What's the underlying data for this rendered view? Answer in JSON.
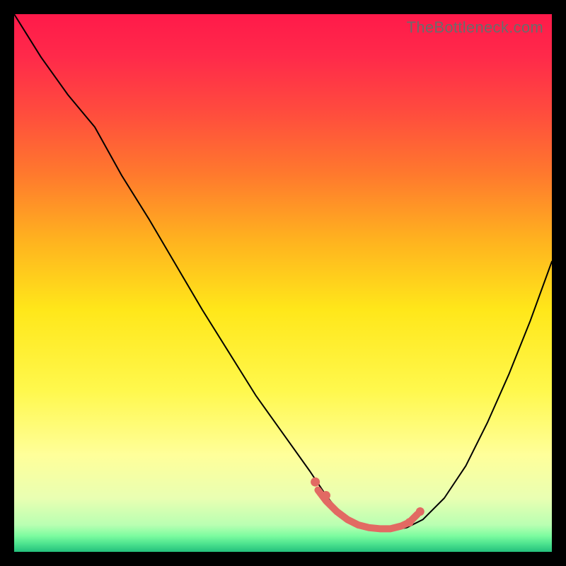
{
  "chart_data": {
    "type": "line",
    "title": "",
    "xlabel": "",
    "ylabel": "",
    "xlim": [
      0,
      100
    ],
    "ylim": [
      0,
      100
    ],
    "watermark": "TheBottleneck.com",
    "background_gradient": {
      "stops": [
        {
          "offset": 0.0,
          "color": "#ff1a4a"
        },
        {
          "offset": 0.08,
          "color": "#ff2a4a"
        },
        {
          "offset": 0.18,
          "color": "#ff4b3e"
        },
        {
          "offset": 0.3,
          "color": "#ff7a2d"
        },
        {
          "offset": 0.42,
          "color": "#ffb21f"
        },
        {
          "offset": 0.55,
          "color": "#ffe71a"
        },
        {
          "offset": 0.7,
          "color": "#fff84d"
        },
        {
          "offset": 0.82,
          "color": "#ffff9a"
        },
        {
          "offset": 0.9,
          "color": "#e9ffb2"
        },
        {
          "offset": 0.95,
          "color": "#b9ffb2"
        },
        {
          "offset": 0.97,
          "color": "#7dfca0"
        },
        {
          "offset": 0.985,
          "color": "#4de38f"
        },
        {
          "offset": 1.0,
          "color": "#24c07c"
        }
      ]
    },
    "series": [
      {
        "name": "bottleneck-curve",
        "color": "#000000",
        "width": 2,
        "x": [
          0,
          5,
          10,
          15,
          20,
          25,
          30,
          35,
          40,
          45,
          50,
          55,
          58,
          60,
          62,
          65,
          68,
          70,
          73,
          76,
          80,
          84,
          88,
          92,
          96,
          100
        ],
        "y": [
          100,
          92,
          85,
          79,
          70,
          62,
          53.5,
          45,
          37,
          29,
          22,
          15,
          10.5,
          8,
          6,
          4.5,
          4,
          4,
          4.5,
          6,
          10,
          16,
          24,
          33,
          43,
          54
        ]
      }
    ],
    "highlight_segment": {
      "color": "#e26a63",
      "width": 10,
      "points_x": [
        56.5,
        58,
        60,
        62,
        64,
        66,
        68,
        70,
        72,
        73.5,
        75
      ],
      "points_y": [
        11.5,
        9.5,
        7.5,
        6.0,
        5.0,
        4.5,
        4.3,
        4.3,
        4.8,
        5.5,
        7.0
      ],
      "endpoints": [
        {
          "x": 56.0,
          "y": 13.0,
          "r": 6.5
        },
        {
          "x": 58.0,
          "y": 10.5,
          "r": 6.2
        },
        {
          "x": 73.5,
          "y": 5.5,
          "r": 6.0
        },
        {
          "x": 75.5,
          "y": 7.5,
          "r": 6.0
        }
      ]
    }
  }
}
